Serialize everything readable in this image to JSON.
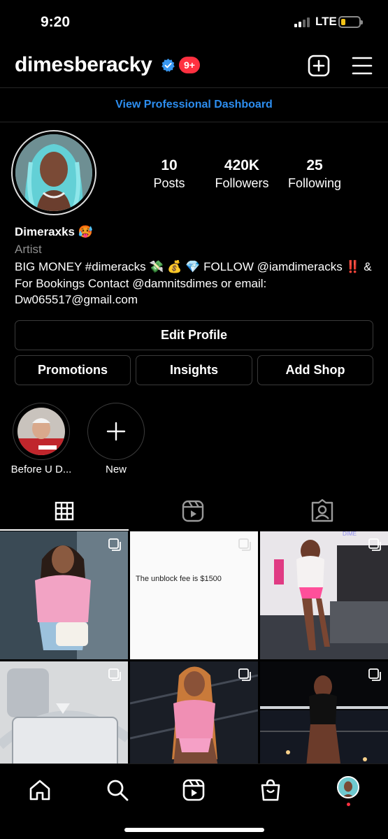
{
  "status_bar": {
    "time": "9:20",
    "network": "LTE"
  },
  "header": {
    "username": "dimesberacky",
    "notifications_badge": "9+"
  },
  "professional_dashboard_link": "View Professional Dashboard",
  "profile": {
    "stats": [
      {
        "value": "10",
        "label": "Posts"
      },
      {
        "value": "420K",
        "label": "Followers"
      },
      {
        "value": "25",
        "label": "Following"
      }
    ],
    "display_name": "Dimeraxks 🥵",
    "category": "Artist",
    "bio": "BIG MONEY #dimeracks 💸 💰 💎 FOLLOW @iamdimeracks ‼️ & For Bookings Contact @damnitsdimes or email: Dw065517@gmail.com"
  },
  "buttons": {
    "edit_profile": "Edit Profile",
    "promotions": "Promotions",
    "insights": "Insights",
    "add_shop": "Add Shop"
  },
  "highlights": [
    {
      "label": "Before U D..."
    },
    {
      "label": "New"
    }
  ],
  "tabs": [
    {
      "icon": "grid-icon",
      "active": true
    },
    {
      "icon": "reels-icon",
      "active": false
    },
    {
      "icon": "tagged-icon",
      "active": false
    }
  ],
  "posts": [
    {
      "image": "photo-pink-top",
      "multi": true
    },
    {
      "image": "text-post",
      "text": "The unblock fee is $1500",
      "multi": true
    },
    {
      "image": "photo-bedroom",
      "multi": true
    },
    {
      "image": "photo-chain-pendant",
      "multi": true
    },
    {
      "image": "photo-night-city",
      "multi": true
    },
    {
      "image": "photo-balcony",
      "multi": true
    }
  ],
  "bottom_nav": [
    {
      "icon": "home-icon"
    },
    {
      "icon": "search-icon"
    },
    {
      "icon": "reels-icon"
    },
    {
      "icon": "shop-icon"
    },
    {
      "icon": "profile-avatar"
    }
  ],
  "colors": {
    "accent_blue": "#2d8ef0",
    "badge_red": "#ff3040",
    "verified_blue": "#3897f0",
    "battery_yellow": "#f2c318"
  }
}
